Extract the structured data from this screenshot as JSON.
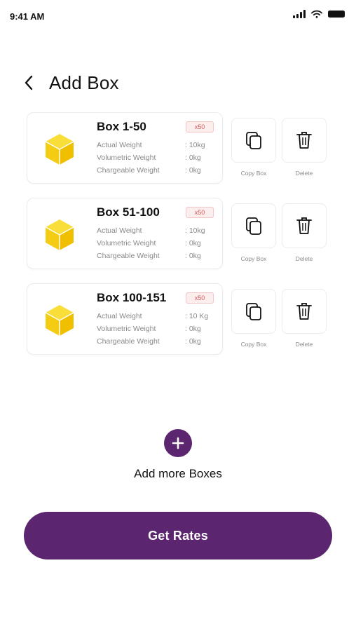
{
  "status_bar": {
    "time": "9:41 AM"
  },
  "header": {
    "title": "Add Box"
  },
  "boxes": [
    {
      "name": "Box 1-50",
      "quantity": "x50",
      "details": [
        {
          "label": "Actual Weight",
          "value": ": 10kg"
        },
        {
          "label": "Volumetric Weight",
          "value": ": 0kg"
        },
        {
          "label": "Chargeable Weight",
          "value": ": 0kg"
        }
      ],
      "copy_label": "Copy Box",
      "delete_label": "Delete"
    },
    {
      "name": "Box 51-100",
      "quantity": "x50",
      "details": [
        {
          "label": "Actual Weight",
          "value": ": 10kg"
        },
        {
          "label": "Volumetric Weight",
          "value": ": 0kg"
        },
        {
          "label": "Chargeable Weight",
          "value": ": 0kg"
        }
      ],
      "copy_label": "Copy Box",
      "delete_label": "Delete"
    },
    {
      "name": "Box 100-151",
      "quantity": "x50",
      "details": [
        {
          "label": "Actual Weight",
          "value": ": 10 Kg"
        },
        {
          "label": "Volumetric Weight",
          "value": ": 0kg"
        },
        {
          "label": "Chargeable Weight",
          "value": ": 0kg"
        }
      ],
      "copy_label": "Copy Box",
      "delete_label": "Delete"
    }
  ],
  "add_more": {
    "label": "Add more Boxes"
  },
  "footer": {
    "button_label": "Get Rates"
  },
  "colors": {
    "primary": "#5c2570",
    "box_icon": "#f5cc14",
    "badge_bg": "#fdeeee",
    "badge_text": "#d05a5a"
  },
  "icons": {
    "back": "chevron-left-icon",
    "box": "cube-icon",
    "copy": "copy-icon",
    "delete": "trash-icon",
    "add": "plus-icon"
  }
}
